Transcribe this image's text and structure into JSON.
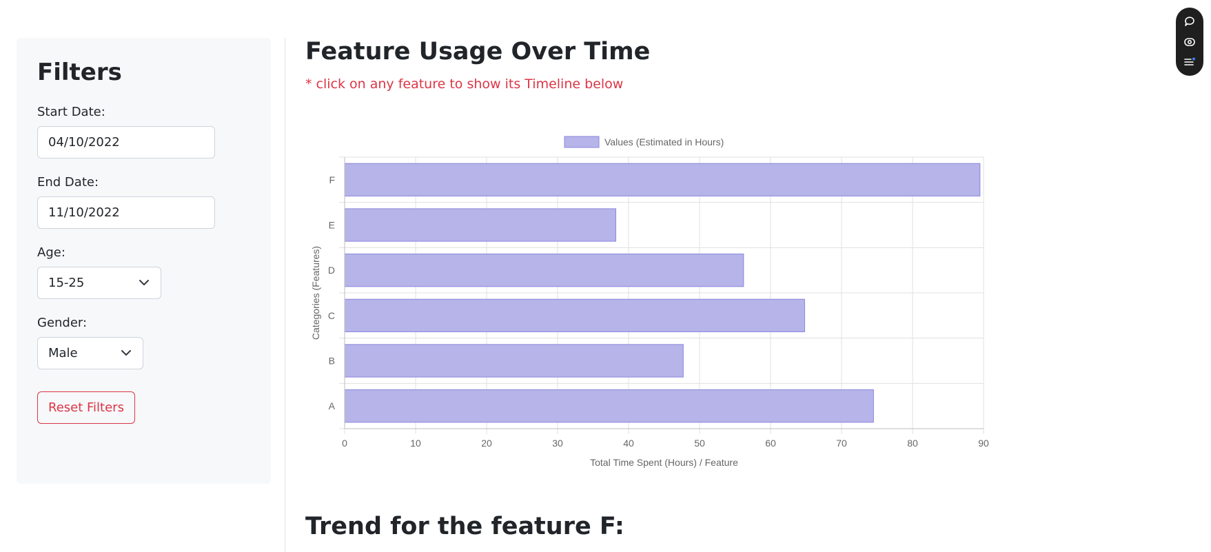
{
  "filters": {
    "title": "Filters",
    "start_date_label": "Start Date:",
    "start_date_value": "04/10/2022",
    "end_date_label": "End Date:",
    "end_date_value": "11/10/2022",
    "age_label": "Age:",
    "age_value": "15-25",
    "gender_label": "Gender:",
    "gender_value": "Male",
    "reset_label": "Reset Filters"
  },
  "main": {
    "title": "Feature Usage Over Time",
    "hint": "* click on any feature to show its Timeline below",
    "trend_title": "Trend for the feature F:"
  },
  "colors": {
    "bar_fill": "#b6b4e8",
    "bar_stroke": "#8c86e0",
    "accent_red": "#dc3545"
  },
  "floating_toolbar": {
    "icons": [
      "chat-icon",
      "eye-icon",
      "list-icon"
    ]
  },
  "chart_data": {
    "type": "bar",
    "orientation": "horizontal",
    "categories": [
      "A",
      "B",
      "C",
      "D",
      "E",
      "F"
    ],
    "series": [
      {
        "name": "Values (Estimated in Hours)",
        "values": [
          74.5,
          47.7,
          64.8,
          56.2,
          38.2,
          89.5
        ]
      }
    ],
    "xlabel": "Total Time Spent (Hours) / Feature",
    "ylabel": "Categories (Features)",
    "xlim": [
      0,
      90
    ],
    "xticks": [
      "0",
      "10",
      "20",
      "30",
      "40",
      "50",
      "60",
      "70",
      "80",
      "90"
    ],
    "grid": true,
    "legend": "top-center"
  }
}
